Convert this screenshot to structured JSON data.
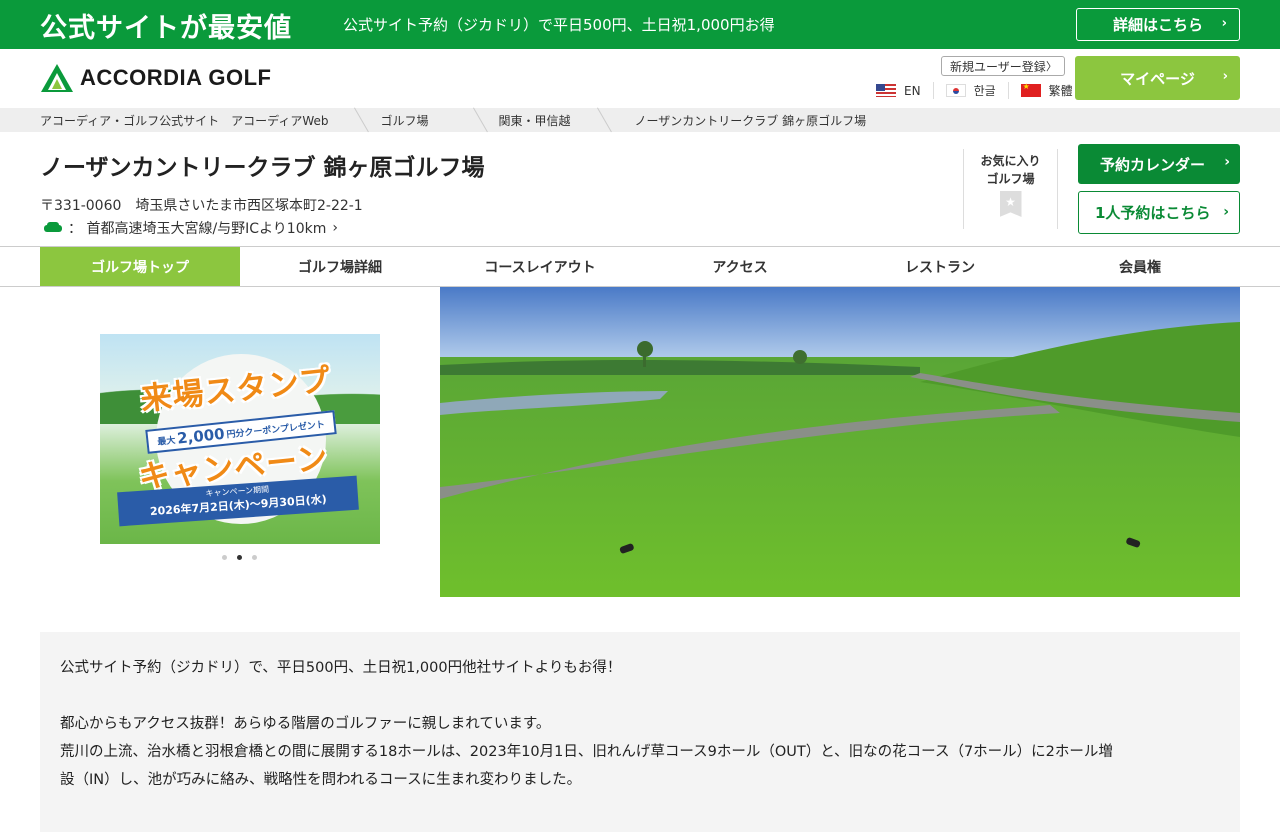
{
  "promo": {
    "title": "公式サイトが最安値",
    "subtitle": "公式サイト予約（ジカドリ）で平日500円、土日祝1,000円お得",
    "button": "詳細はこちら"
  },
  "header": {
    "logo_text": "ACCORDIA GOLF",
    "register": "新規ユーザー登録",
    "languages": [
      "EN",
      "한글",
      "繁體"
    ],
    "mypage": "マイページ"
  },
  "breadcrumb": [
    "アコーディア・ゴルフ公式サイト　アコーディアWeb",
    "ゴルフ場",
    "関東・甲信越",
    "ノーザンカントリークラブ 錦ヶ原ゴルフ場"
  ],
  "course": {
    "name": "ノーザンカントリークラブ 錦ヶ原ゴルフ場",
    "address": "〒331-0060　埼玉県さいたま市西区塚本町2-22-1",
    "access": "：  首都高速埼玉大宮線/与野ICより10km",
    "favorite": [
      "お気に入り",
      "ゴルフ場"
    ],
    "reserve_calendar": "予約カレンダー",
    "solo_reserve": "1人予約はこちら"
  },
  "tabs": [
    "ゴルフ場トップ",
    "ゴルフ場詳細",
    "コースレイアウト",
    "アクセス",
    "レストラン",
    "会員権"
  ],
  "banner": {
    "title1": "来場スタンプ",
    "ribbon_prefix": "最大",
    "ribbon_amount": "2,000",
    "ribbon_suffix": "円分クーポンプレゼント",
    "title2": "キャンペーン",
    "period_label": "キャンペーン期間",
    "period": "2026年7月2日(木)～9月30日(水)",
    "slides": 3,
    "active_slide": 2
  },
  "description": {
    "line1": "公式サイト予約（ジカドリ）で、平日500円、土日祝1,000円他社サイトよりもお得！",
    "line2": "都心からもアクセス抜群！あらゆる階層のゴルファーに親しまれています。",
    "line3": "荒川の上流、治水橋と羽根倉橋との間に展開する18ホールは、2023年10月1日、旧れんげ草コース9ホール（OUT）と、旧なの花コース（7ホール）に2ホール増",
    "line4": "設（IN）し、池が巧みに絡み、戦略性を問われるコースに生まれ変わりました。"
  },
  "colors": {
    "brand_green": "#0a9a3b",
    "accent_lime": "#8cc63f",
    "dark_green": "#0a8a35"
  }
}
